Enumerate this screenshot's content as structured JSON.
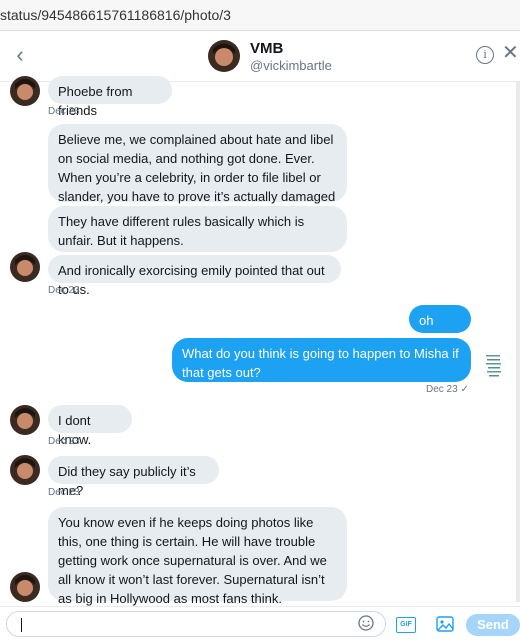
{
  "browser": {
    "url": "status/945486615761186816/photo/3"
  },
  "header": {
    "name": "VMB",
    "handle": "@vickimbartle"
  },
  "messages": [
    {
      "text": "Phoebe from friends"
    },
    {
      "text": "Believe me, we complained about hate and libel on social media, and nothing got done. Ever. When you’re a celebrity, in order to file libel or slander, you have to prove it’s actually damaged you financially."
    },
    {
      "text": "They have different rules basically which is unfair. But it happens."
    },
    {
      "text": "And ironically exorcising emily pointed that out to us."
    },
    {
      "text": "oh wow"
    },
    {
      "text": "What do you think is going to happen to Misha if that gets out?"
    },
    {
      "text": "I dont know."
    },
    {
      "text": "Did they say publicly it’s me?"
    },
    {
      "text": "You know even if he keeps doing photos like this, one thing is certain. He will have trouble getting work once supernatural is over. And we all know it won’t last forever.  Supernatural isn’t as big in Hollywood as most fans think."
    }
  ],
  "timestamps": {
    "t1": "Dec 23",
    "t2": "Dec 23",
    "t3": "Dec 23 ✓",
    "t4": "Dec 23",
    "t5": "Dec 23"
  },
  "composer": {
    "gif_label": "GIF",
    "send_label": "Send"
  },
  "icons": {
    "back": "chevron-left-icon",
    "info": "info-icon",
    "close": "close-icon",
    "emoji": "emoji-icon",
    "gif": "gif-icon",
    "media": "image-icon"
  },
  "colors": {
    "accent": "#1da1f2",
    "bubble_in": "#e6ecf0",
    "send_disabled": "#a5d6f9"
  }
}
